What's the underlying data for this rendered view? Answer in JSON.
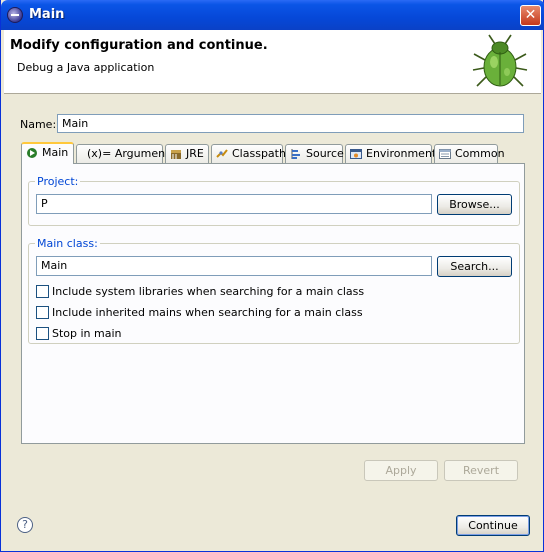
{
  "window": {
    "title": "Main",
    "close_label": "✕"
  },
  "banner": {
    "title": "Modify configuration and continue.",
    "subtitle": "Debug a Java application",
    "icon": "bug-icon"
  },
  "name_field": {
    "label": "Name:",
    "value": "Main"
  },
  "tabs": [
    {
      "label": "Main",
      "icon": "main-tab-icon",
      "active": true
    },
    {
      "label": "Arguments",
      "icon": "arguments-icon",
      "prefix": "(x)="
    },
    {
      "label": "JRE",
      "icon": "jre-icon"
    },
    {
      "label": "Classpath",
      "icon": "classpath-icon"
    },
    {
      "label": "Source",
      "icon": "source-icon"
    },
    {
      "label": "Environment",
      "icon": "environment-icon"
    },
    {
      "label": "Common",
      "icon": "common-icon"
    }
  ],
  "project": {
    "group_label": "Project:",
    "value": "P",
    "browse_label": "Browse..."
  },
  "main_class": {
    "group_label": "Main class:",
    "value": "Main",
    "search_label": "Search..."
  },
  "options": [
    {
      "label": "Include system libraries when searching for a main class",
      "checked": false
    },
    {
      "label": "Include inherited mains when searching for a main class",
      "checked": false
    },
    {
      "label": "Stop in main",
      "checked": false
    }
  ],
  "actions": {
    "apply_label": "Apply",
    "revert_label": "Revert",
    "continue_label": "Continue",
    "help_label": "?"
  }
}
